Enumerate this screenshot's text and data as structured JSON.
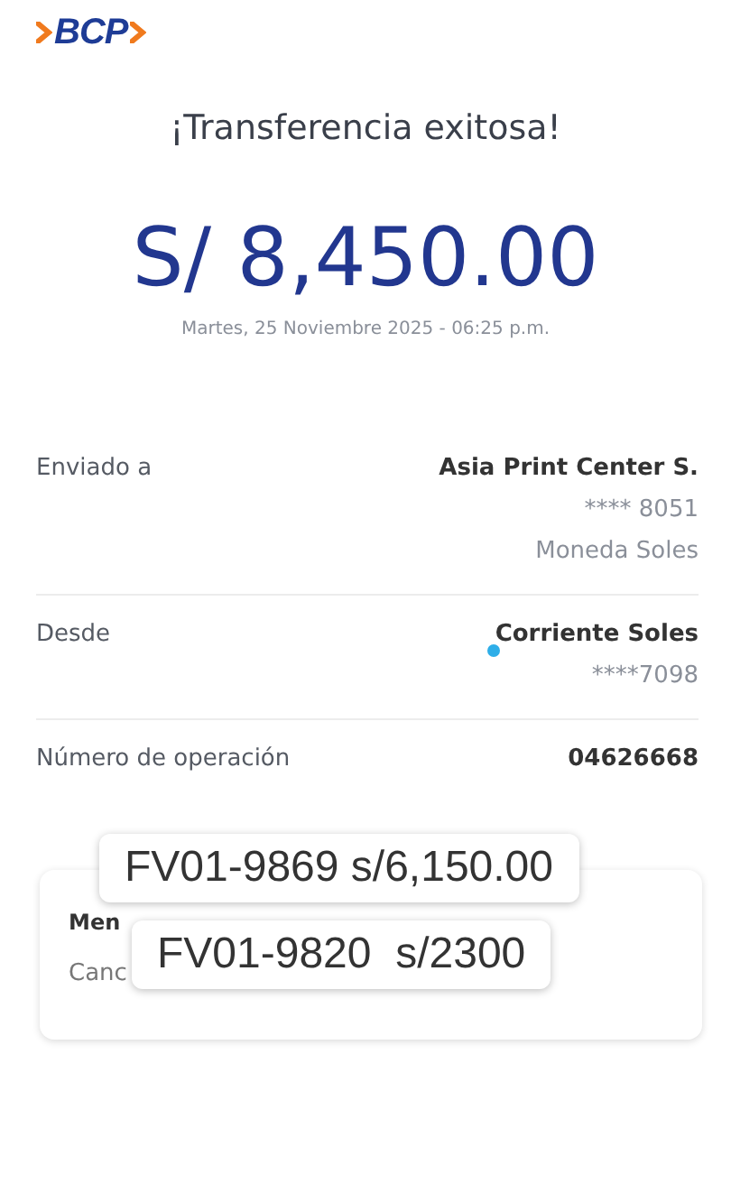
{
  "header": {
    "logo": "BCP"
  },
  "title": "¡Transferencia exitosa!",
  "amount": "S/ 8,450.00",
  "date": "Martes, 25 Noviembre 2025 - 06:25 p.m.",
  "details": [
    {
      "label": "Enviado a",
      "lines": [
        "Asia Print Center S.",
        "**** 8051",
        "Moneda Soles"
      ]
    },
    {
      "label": "Desde",
      "lines": [
        "Corriente Soles",
        "****7098"
      ]
    },
    {
      "label": "Número de operación",
      "lines": [
        "04626668"
      ]
    }
  ],
  "card": {
    "heading": "Men",
    "text": "Canc"
  },
  "notes": [
    "FV01-9869 s/6,150.00",
    "FV01-9820  s/2300"
  ]
}
